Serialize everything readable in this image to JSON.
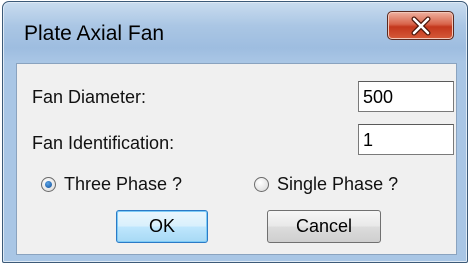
{
  "window": {
    "title": "Plate Axial Fan",
    "close_glyph": "x"
  },
  "form": {
    "fan_diameter_label": "Fan Diameter:",
    "fan_diameter_value": "500",
    "fan_identification_label": "Fan Identification:",
    "fan_identification_value": "1",
    "phase_options": [
      {
        "label": "Three Phase ?",
        "selected": true
      },
      {
        "label": "Single Phase ?",
        "selected": false
      }
    ]
  },
  "buttons": {
    "ok_label": "OK",
    "cancel_label": "Cancel"
  },
  "colors": {
    "titlebar": "#a9c6e5",
    "close_button": "#c3371c",
    "client_background": "#f0f0f0",
    "default_button_border": "#2b7ac6"
  }
}
